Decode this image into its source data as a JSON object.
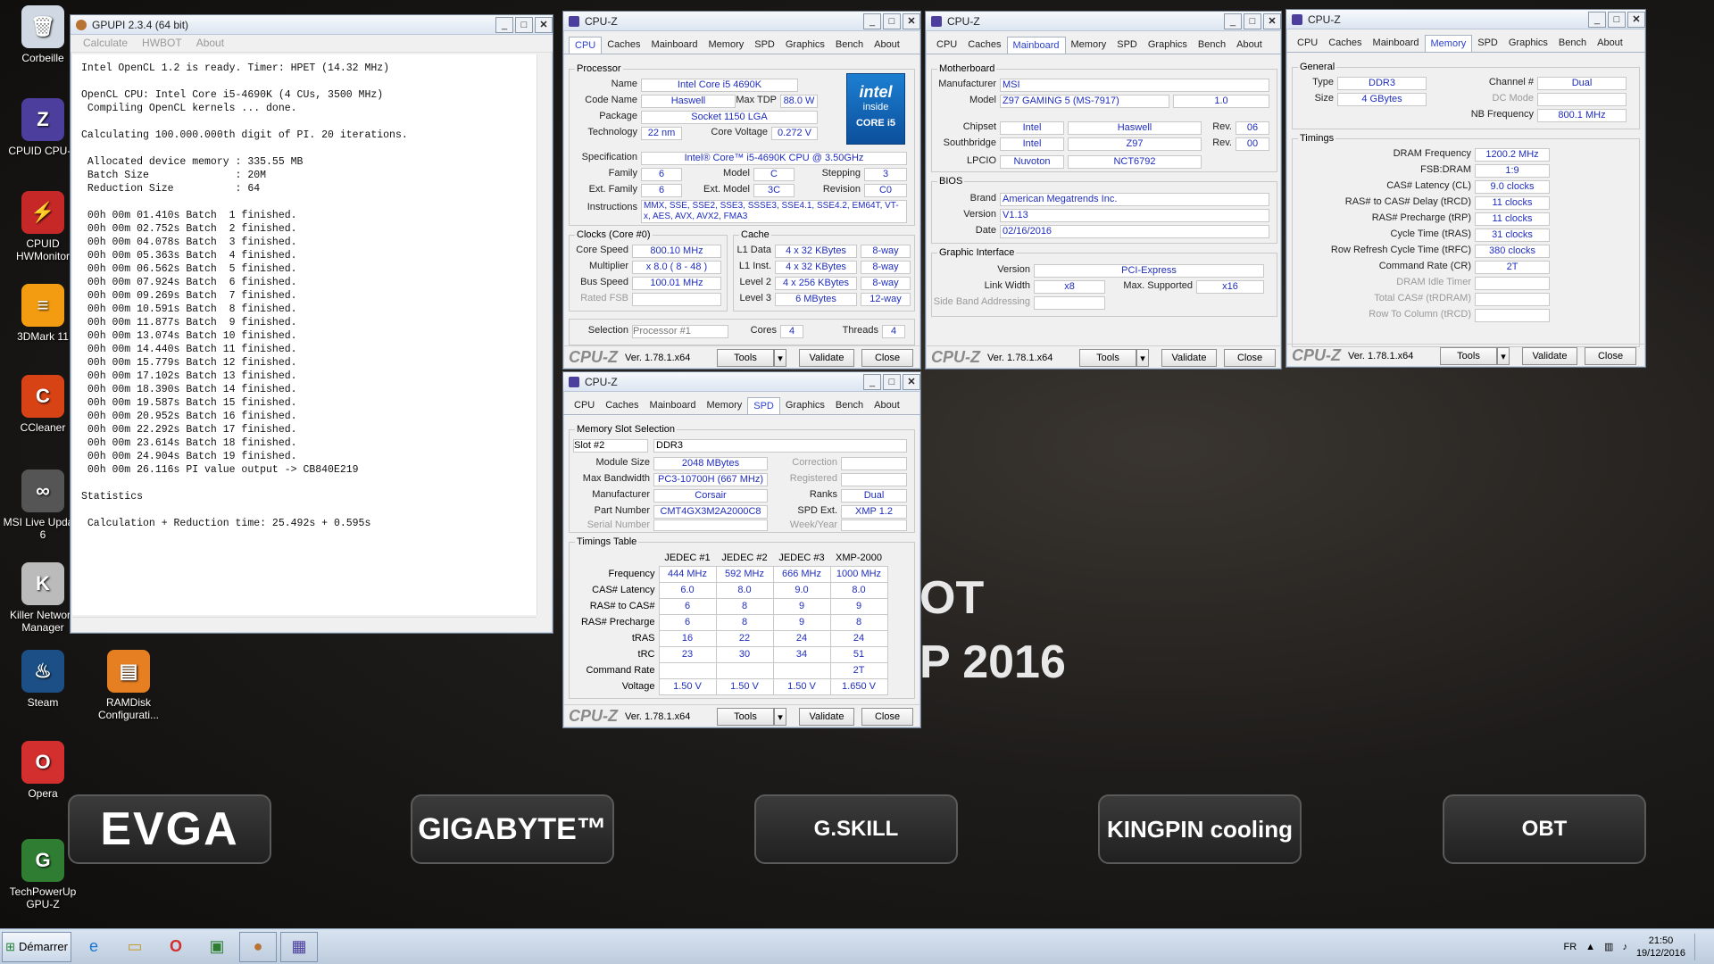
{
  "desktop": {
    "icons": [
      {
        "label": "Corbeille",
        "glyph": "🗑",
        "color": "#cfd8e3"
      },
      {
        "label": "CPUID CPU-Z",
        "glyph": "Z",
        "color": "#4b3e9c"
      },
      {
        "label": "CPUID HWMonitor",
        "glyph": "⚡",
        "color": "#c62828"
      },
      {
        "label": "3DMark 11",
        "glyph": "≡",
        "color": "#f39c12"
      },
      {
        "label": "CCleaner",
        "glyph": "C",
        "color": "#d84315"
      },
      {
        "label": "MSI Live Update 6",
        "glyph": "∞",
        "color": "#555"
      },
      {
        "label": "Killer Network Manager",
        "glyph": "K",
        "color": "#bbb"
      },
      {
        "label": "Steam",
        "glyph": "♨",
        "color": "#1b4f85"
      },
      {
        "label": "RAMDisk Configurati...",
        "glyph": "▤",
        "color": "#e67e22"
      },
      {
        "label": "Opera",
        "glyph": "O",
        "color": "#d32f2f"
      },
      {
        "label": "TechPowerUp GPU-Z",
        "glyph": "G",
        "color": "#2e7d32"
      }
    ],
    "big_text_1": "OT",
    "big_text_2": "P 2016",
    "banners": [
      "EVGA",
      "GIGABYTE™",
      "G.SKILL",
      "KINGPIN cooling",
      "OBT"
    ]
  },
  "gpupi": {
    "title": "GPUPI 2.3.4 (64 bit)",
    "menu": [
      "Calculate",
      "HWBOT",
      "About"
    ],
    "console": "Intel OpenCL 1.2 is ready. Timer: HPET (14.32 MHz)\n\nOpenCL CPU: Intel Core i5-4690K (4 CUs, 3500 MHz)\n Compiling OpenCL kernels ... done.\n\nCalculating 100.000.000th digit of PI. 20 iterations.\n\n Allocated device memory : 335.55 MB\n Batch Size              : 20M\n Reduction Size          : 64\n\n 00h 00m 01.410s Batch  1 finished.\n 00h 00m 02.752s Batch  2 finished.\n 00h 00m 04.078s Batch  3 finished.\n 00h 00m 05.363s Batch  4 finished.\n 00h 00m 06.562s Batch  5 finished.\n 00h 00m 07.924s Batch  6 finished.\n 00h 00m 09.269s Batch  7 finished.\n 00h 00m 10.591s Batch  8 finished.\n 00h 00m 11.877s Batch  9 finished.\n 00h 00m 13.074s Batch 10 finished.\n 00h 00m 14.440s Batch 11 finished.\n 00h 00m 15.779s Batch 12 finished.\n 00h 00m 17.102s Batch 13 finished.\n 00h 00m 18.390s Batch 14 finished.\n 00h 00m 19.587s Batch 15 finished.\n 00h 00m 20.952s Batch 16 finished.\n 00h 00m 22.292s Batch 17 finished.\n 00h 00m 23.614s Batch 18 finished.\n 00h 00m 24.904s Batch 19 finished.\n 00h 00m 26.116s PI value output -> CB840E219\n\nStatistics\n\n Calculation + Reduction time: 25.492s + 0.595s"
  },
  "cpuz_common": {
    "title": "CPU-Z",
    "tabs": [
      "CPU",
      "Caches",
      "Mainboard",
      "Memory",
      "SPD",
      "Graphics",
      "Bench",
      "About"
    ],
    "logo": "CPU-Z",
    "version": "Ver. 1.78.1.x64",
    "tools": "Tools",
    "validate": "Validate",
    "close": "Close"
  },
  "cpu": {
    "processor_label": "Processor",
    "name_l": "Name",
    "name": "Intel Core i5 4690K",
    "codename_l": "Code Name",
    "codename": "Haswell",
    "maxtdp_l": "Max TDP",
    "maxtdp": "88.0 W",
    "package_l": "Package",
    "package": "Socket 1150 LGA",
    "tech_l": "Technology",
    "tech": "22 nm",
    "cv_l": "Core Voltage",
    "cv": "0.272 V",
    "spec_l": "Specification",
    "spec": "Intel® Core™ i5-4690K CPU @ 3.50GHz",
    "family_l": "Family",
    "family": "6",
    "model_l": "Model",
    "model": "C",
    "stepping_l": "Stepping",
    "stepping": "3",
    "extfam_l": "Ext. Family",
    "extfam": "6",
    "extmod_l": "Ext. Model",
    "extmod": "3C",
    "revision_l": "Revision",
    "revision": "C0",
    "instr_l": "Instructions",
    "instr": "MMX, SSE, SSE2, SSE3, SSSE3, SSE4.1, SSE4.2, EM64T, VT-x, AES, AVX, AVX2, FMA3",
    "clocks_label": "Clocks (Core #0)",
    "corespeed_l": "Core Speed",
    "corespeed": "800.10 MHz",
    "mult_l": "Multiplier",
    "mult": "x 8.0 ( 8 - 48 )",
    "bus_l": "Bus Speed",
    "bus": "100.01 MHz",
    "ratedfsb_l": "Rated FSB",
    "cache_label": "Cache",
    "l1d_l": "L1 Data",
    "l1d": "4 x 32 KBytes",
    "l1d_w": "8-way",
    "l1i_l": "L1 Inst.",
    "l1i": "4 x 32 KBytes",
    "l1i_w": "8-way",
    "l2_l": "Level 2",
    "l2": "4 x 256 KBytes",
    "l2_w": "8-way",
    "l3_l": "Level 3",
    "l3": "6 MBytes",
    "l3_w": "12-way",
    "selection_l": "Selection",
    "selection": "Processor #1",
    "cores_l": "Cores",
    "cores": "4",
    "threads_l": "Threads",
    "threads": "4",
    "badge_1": "intel",
    "badge_2": "inside",
    "badge_3": "CORE i5"
  },
  "mainboard": {
    "mb_label": "Motherboard",
    "manu_l": "Manufacturer",
    "manu": "MSI",
    "model_l": "Model",
    "model": "Z97 GAMING 5 (MS-7917)",
    "model_rev": "1.0",
    "chipset_l": "Chipset",
    "chipset": "Intel",
    "chipset2": "Haswell",
    "rev_l": "Rev.",
    "chipset_rev": "06",
    "south_l": "Southbridge",
    "south": "Intel",
    "south2": "Z97",
    "south_rev": "00",
    "lpcio_l": "LPCIO",
    "lpcio": "Nuvoton",
    "lpcio2": "NCT6792",
    "bios_label": "BIOS",
    "brand_l": "Brand",
    "brand": "American Megatrends Inc.",
    "version_l": "Version",
    "version": "V1.13",
    "date_l": "Date",
    "date": "02/16/2016",
    "gi_label": "Graphic Interface",
    "giver_l": "Version",
    "giver": "PCI-Express",
    "lw_l": "Link Width",
    "lw": "x8",
    "ms_l": "Max. Supported",
    "ms": "x16",
    "sba_l": "Side Band Addressing"
  },
  "memory": {
    "general_label": "General",
    "type_l": "Type",
    "type": "DDR3",
    "channel_l": "Channel #",
    "channel": "Dual",
    "size_l": "Size",
    "size": "4 GBytes",
    "dcmode_l": "DC Mode",
    "nbfreq_l": "NB Frequency",
    "nbfreq": "800.1 MHz",
    "timings_label": "Timings",
    "rows": [
      {
        "l": "DRAM Frequency",
        "v": "1200.2 MHz",
        "dim": false
      },
      {
        "l": "FSB:DRAM",
        "v": "1:9",
        "dim": false
      },
      {
        "l": "CAS# Latency (CL)",
        "v": "9.0 clocks",
        "dim": false
      },
      {
        "l": "RAS# to CAS# Delay (tRCD)",
        "v": "11 clocks",
        "dim": false
      },
      {
        "l": "RAS# Precharge (tRP)",
        "v": "11 clocks",
        "dim": false
      },
      {
        "l": "Cycle Time (tRAS)",
        "v": "31 clocks",
        "dim": false
      },
      {
        "l": "Row Refresh Cycle Time (tRFC)",
        "v": "380 clocks",
        "dim": false
      },
      {
        "l": "Command Rate (CR)",
        "v": "2T",
        "dim": false
      },
      {
        "l": "DRAM Idle Timer",
        "v": "",
        "dim": true
      },
      {
        "l": "Total CAS# (tRDRAM)",
        "v": "",
        "dim": true
      },
      {
        "l": "Row To Column (tRCD)",
        "v": "",
        "dim": true
      }
    ]
  },
  "spd": {
    "mss_label": "Memory Slot Selection",
    "slot": "Slot #2",
    "memtype": "DDR3",
    "modsize_l": "Module Size",
    "modsize": "2048 MBytes",
    "correction_l": "Correction",
    "maxbw_l": "Max Bandwidth",
    "maxbw": "PC3-10700H (667 MHz)",
    "registered_l": "Registered",
    "manu_l": "Manufacturer",
    "manu": "Corsair",
    "ranks_l": "Ranks",
    "ranks": "Dual",
    "part_l": "Part Number",
    "part": "CMT4GX3M2A2000C8",
    "spdext_l": "SPD Ext.",
    "spdext": "XMP 1.2",
    "serial_l": "Serial Number",
    "week_l": "Week/Year",
    "tt_label": "Timings Table",
    "headers": [
      "JEDEC #1",
      "JEDEC #2",
      "JEDEC #3",
      "XMP-2000"
    ],
    "rows": [
      {
        "l": "Frequency",
        "v": [
          "444 MHz",
          "592 MHz",
          "666 MHz",
          "1000 MHz"
        ]
      },
      {
        "l": "CAS# Latency",
        "v": [
          "6.0",
          "8.0",
          "9.0",
          "8.0"
        ]
      },
      {
        "l": "RAS# to CAS#",
        "v": [
          "6",
          "8",
          "9",
          "9"
        ]
      },
      {
        "l": "RAS# Precharge",
        "v": [
          "6",
          "8",
          "9",
          "8"
        ]
      },
      {
        "l": "tRAS",
        "v": [
          "16",
          "22",
          "24",
          "24"
        ]
      },
      {
        "l": "tRC",
        "v": [
          "23",
          "30",
          "34",
          "51"
        ]
      },
      {
        "l": "Command Rate",
        "v": [
          "",
          "",
          "",
          "2T"
        ]
      },
      {
        "l": "Voltage",
        "v": [
          "1.50 V",
          "1.50 V",
          "1.50 V",
          "1.650 V"
        ]
      }
    ]
  },
  "taskbar": {
    "start": "Démarrer",
    "lang": "FR",
    "time": "21:50",
    "date": "19/12/2016"
  }
}
